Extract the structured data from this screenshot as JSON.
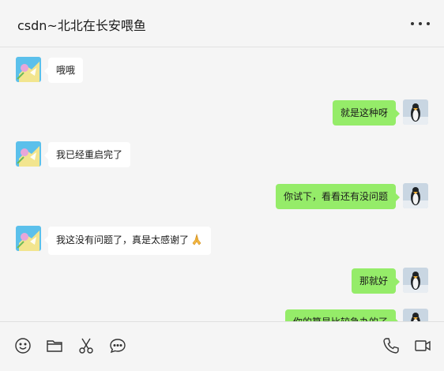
{
  "header": {
    "title": "csdn~北北在长安喂鱼",
    "more_icon": "more-horizontal-icon"
  },
  "messages": [
    {
      "side": "left",
      "text": "哦哦"
    },
    {
      "side": "right",
      "text": "就是这种呀"
    },
    {
      "side": "left",
      "text": "我已经重启完了"
    },
    {
      "side": "right",
      "text": "你试下，看看还有没问题"
    },
    {
      "side": "left",
      "text": "我这没有问题了，真是太感谢了",
      "emoji": "folded-hands"
    },
    {
      "side": "right",
      "text": "那就好"
    },
    {
      "side": "right",
      "text": "你的算是比较急办的了"
    }
  ],
  "toolbar": {
    "left_icons": [
      "emoji-icon",
      "folder-icon",
      "scissors-icon",
      "chat-bubble-icon"
    ],
    "right_icons": [
      "phone-icon",
      "video-call-icon"
    ]
  },
  "colors": {
    "sent_bubble": "#95ec69",
    "received_bubble": "#ffffff",
    "background": "#f5f5f5"
  }
}
